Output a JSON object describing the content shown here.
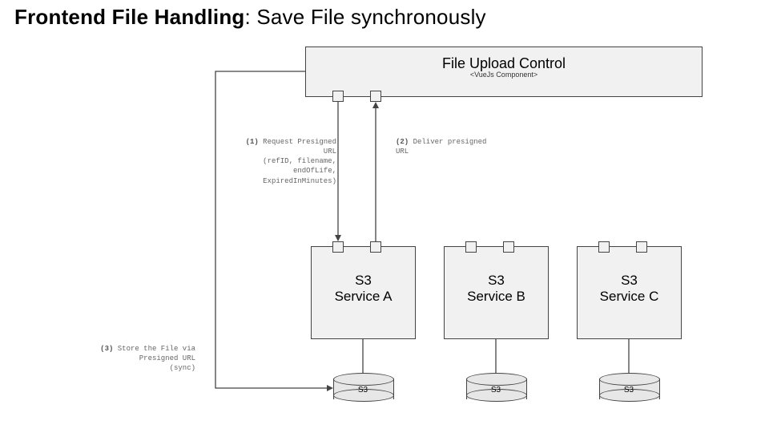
{
  "title": {
    "bold": "Frontend File Handling",
    "rest": ": Save File synchronously"
  },
  "component": {
    "name": "File Upload Control",
    "stereotype": "<VueJs Component>"
  },
  "services": {
    "a": "S3\nService A",
    "b": "S3\nService B",
    "c": "S3\nService C"
  },
  "storage_label": "S3",
  "annotations": {
    "a1_num": "(1)",
    "a1_l1": "Request Presigned",
    "a1_l2": "URL",
    "a1_l3": "(refID, filename,",
    "a1_l4": "endOfLife,",
    "a1_l5": "ExpiredInMinutes)",
    "a2_num": "(2)",
    "a2_l1": "Deliver presigned",
    "a2_l2": "URL",
    "a3_num": "(3)",
    "a3_l1": "Store the File via",
    "a3_l2": "Presigned URL",
    "a3_l3": "(sync)"
  }
}
